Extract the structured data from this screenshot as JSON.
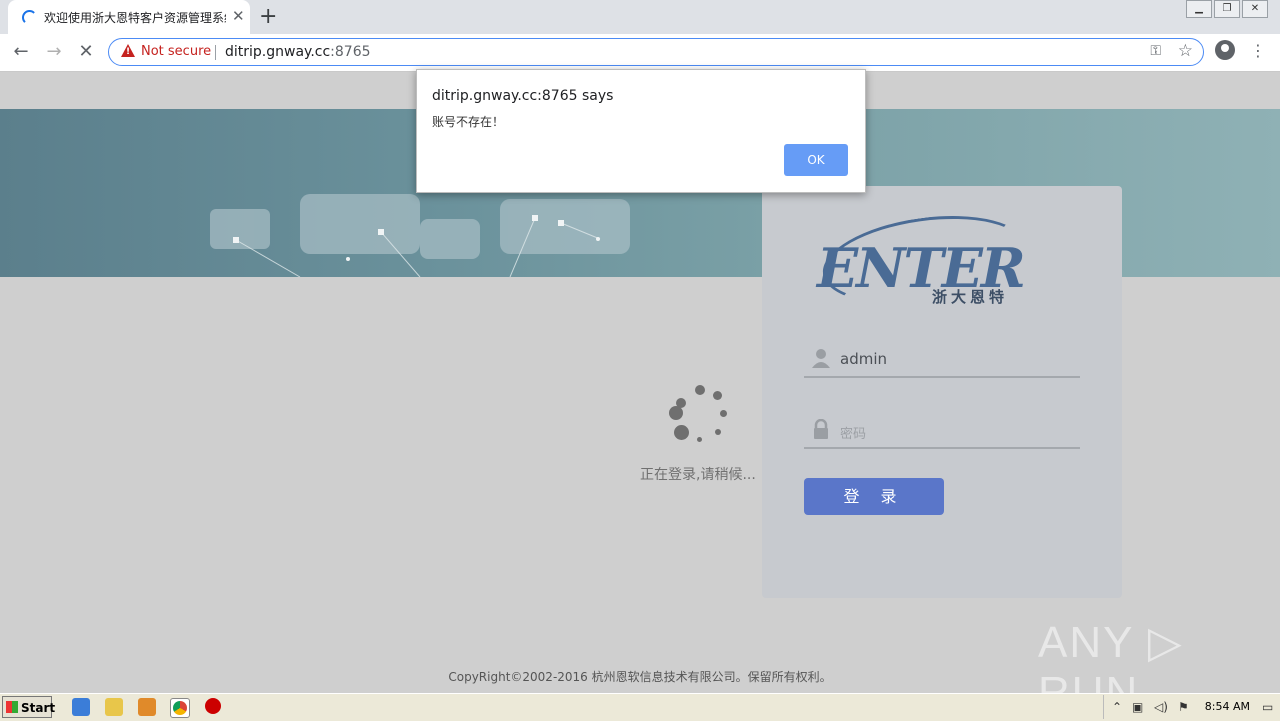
{
  "browser": {
    "tab_title": "欢迎使用浙大恩特客户资源管理系统",
    "tab_close": "✕",
    "new_tab": "+",
    "security_label": "Not secure",
    "url_host": "ditrip.gnway.cc",
    "url_port": ":8765",
    "window_controls": [
      "▁",
      "❐",
      "✕"
    ]
  },
  "login": {
    "logo_text": "ENTER",
    "logo_cn": "浙大恩特",
    "username_value": "admin",
    "password_placeholder": "密码",
    "login_button": "登 录"
  },
  "loading": {
    "text": "正在登录,请稍候..."
  },
  "footer": {
    "copyright": "CopyRight©2002-2016 杭州恩软信息技术有限公司。保留所有权利。"
  },
  "dialog": {
    "title": "ditrip.gnway.cc:8765 says",
    "message": "账号不存在！",
    "ok_label": "OK"
  },
  "watermark": "ANY ▷ RUN",
  "taskbar": {
    "start_label": "Start",
    "clock": "8:54 AM"
  }
}
